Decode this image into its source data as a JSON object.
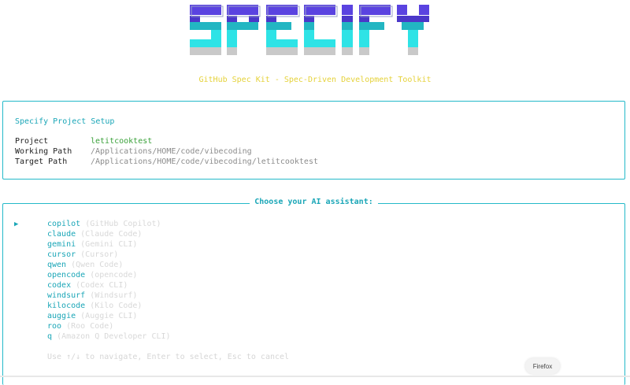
{
  "banner": {
    "logo_text": "SPECIFY",
    "colors": [
      "#5a43e0",
      "#22b6c2",
      "#2ee3e6",
      "#c9c9c9"
    ]
  },
  "tagline": "GitHub Spec Kit - Spec-Driven Development Toolkit",
  "setup": {
    "title": "Specify Project Setup",
    "rows": [
      {
        "key": "Project",
        "value": "letitcooktest"
      },
      {
        "key": "Working Path",
        "value": "/Applications/HOME/code/vibecoding"
      },
      {
        "key": "Target Path",
        "value": "/Applications/HOME/code/vibecoding/letitcooktest"
      }
    ]
  },
  "chooser": {
    "title": "Choose your AI assistant:",
    "pointer": "▶",
    "selected_index": 0,
    "options": [
      {
        "key": "copilot",
        "desc": "(GitHub Copilot)"
      },
      {
        "key": "claude",
        "desc": "(Claude Code)"
      },
      {
        "key": "gemini",
        "desc": "(Gemini CLI)"
      },
      {
        "key": "cursor",
        "desc": "(Cursor)"
      },
      {
        "key": "qwen",
        "desc": "(Qwen Code)"
      },
      {
        "key": "opencode",
        "desc": "(opencode)"
      },
      {
        "key": "codex",
        "desc": "(Codex CLI)"
      },
      {
        "key": "windsurf",
        "desc": "(Windsurf)"
      },
      {
        "key": "kilocode",
        "desc": "(Kilo Code)"
      },
      {
        "key": "auggie",
        "desc": "(Auggie CLI)"
      },
      {
        "key": "roo",
        "desc": "(Roo Code)"
      },
      {
        "key": "q",
        "desc": "(Amazon Q Developer CLI)"
      }
    ],
    "hint": "Use ↑/↓ to navigate, Enter to select, Esc to cancel"
  },
  "browser": {
    "badge": "Firefox"
  }
}
